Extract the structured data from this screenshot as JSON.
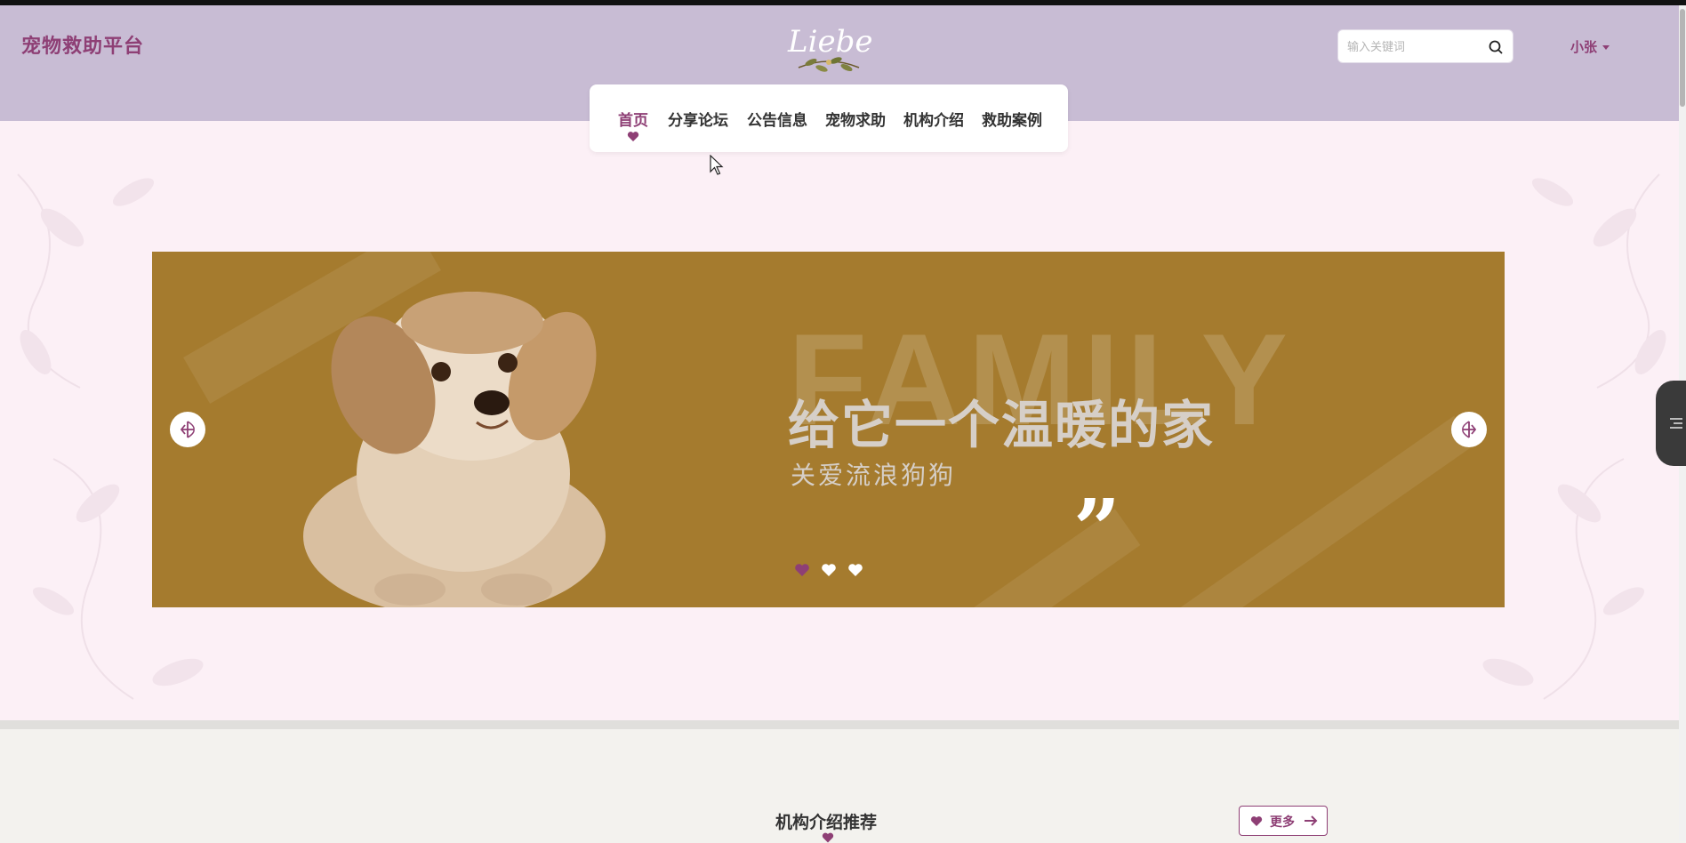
{
  "header": {
    "brand": "宠物救助平台",
    "logo_text": "Liebe",
    "search_placeholder": "输入关键词",
    "user_name": "小张"
  },
  "nav": {
    "items": [
      {
        "label": "首页",
        "active": true
      },
      {
        "label": "分享论坛",
        "active": false
      },
      {
        "label": "公告信息",
        "active": false
      },
      {
        "label": "宠物求助",
        "active": false
      },
      {
        "label": "机构介绍",
        "active": false
      },
      {
        "label": "救助案例",
        "active": false
      }
    ]
  },
  "banner": {
    "bg_word": "FAMILY",
    "slogan": "给它一个温暖的家",
    "subslogan": "关爱流浪狗狗",
    "quote_mark": "”",
    "active_slide_index": 1,
    "slide_count": 3
  },
  "section": {
    "title": "机构介绍推荐",
    "more_label": "更多"
  },
  "colors": {
    "accent": "#8e3f75",
    "header_bg": "#c8bcd4",
    "hero_bg": "#fcf0f6",
    "banner_bg": "#a57b2e"
  },
  "icons": [
    "search-icon",
    "caret-down-icon",
    "heart-icon",
    "prev-arrow-icon",
    "next-arrow-icon",
    "arrow-right-icon",
    "toc-icon"
  ]
}
